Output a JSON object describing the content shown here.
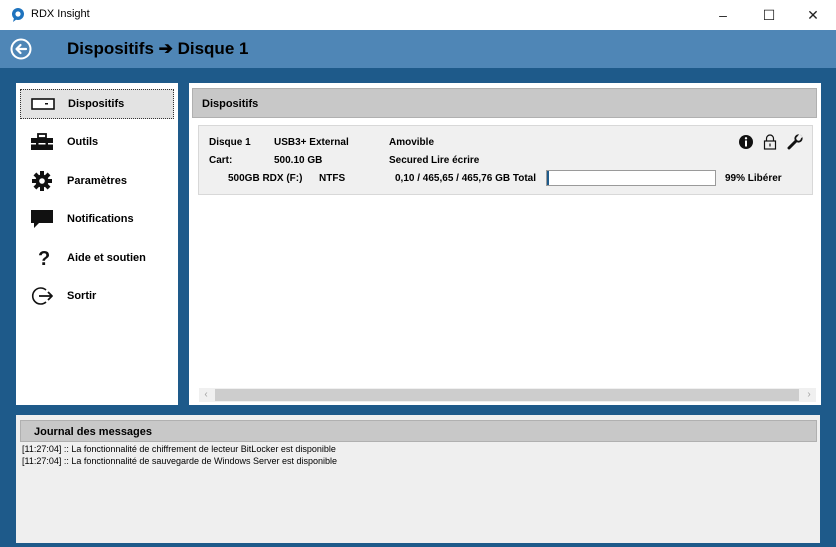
{
  "app": {
    "title": "RDX Insight"
  },
  "window_controls": {
    "minimize": "–",
    "maximize": "☐",
    "close": "✕"
  },
  "header": {
    "title": "Dispositifs ➔ Disque 1"
  },
  "sidebar": {
    "items": [
      {
        "label": "Dispositifs",
        "icon": "drive-icon",
        "active": true
      },
      {
        "label": "Outils",
        "icon": "toolbox-icon"
      },
      {
        "label": "Paramètres",
        "icon": "gear-icon"
      },
      {
        "label": "Notifications",
        "icon": "speech-bubble-icon"
      },
      {
        "label": "Aide et soutien",
        "icon": "question-icon"
      },
      {
        "label": "Sortir",
        "icon": "exit-icon"
      }
    ]
  },
  "main": {
    "title": "Dispositifs",
    "device": {
      "name": "Disque 1",
      "interface": "USB3+ External",
      "type": "Amovible",
      "cart_label": "Cart:",
      "cart_size": "500.10 GB",
      "security": "Secured",
      "mode": "Lire écrire",
      "volume": "500GB RDX (F:)",
      "filesystem": "NTFS",
      "usage": "0,10 / 465,65 / 465,76 GB Total",
      "used_fraction": 0.01,
      "free": "99% Libérer",
      "icons": [
        "info-icon",
        "lock-icon",
        "wrench-icon"
      ]
    }
  },
  "journal": {
    "title": "Journal des messages",
    "lines": [
      "[11:27:04] :: La fonctionnalité de chiffrement de lecteur BitLocker est disponible",
      "[11:27:04] :: La fonctionnalité de sauvegarde de Windows Server est disponible"
    ]
  },
  "colors": {
    "frame": "#1e5a8a",
    "header": "#4f86b6",
    "panel_header": "#c8c8c8"
  }
}
